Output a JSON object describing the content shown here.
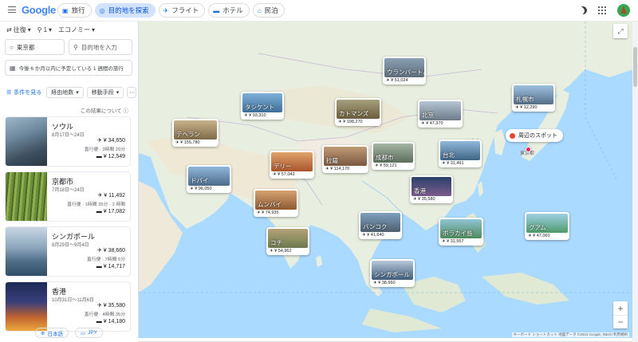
{
  "header": {
    "logo": "Google",
    "tabs": [
      {
        "label": "旅行",
        "icon": "suitcase-icon"
      },
      {
        "label": "目的地を探索",
        "icon": "explore-icon"
      },
      {
        "label": "フライト",
        "icon": "flight-icon"
      },
      {
        "label": "ホテル",
        "icon": "bed-icon"
      },
      {
        "label": "民泊",
        "icon": "house-icon"
      }
    ]
  },
  "search": {
    "trip_type": "往復",
    "passengers": "1",
    "cabin": "エコノミー",
    "origin": "東京都",
    "destination_placeholder": "目的地を入力",
    "dates_placeholder": "今後 6 か月以内に予定している 1 週間の旅行"
  },
  "filters": {
    "all_filters": "条件を見る",
    "stops": "経由地数",
    "transport": "移動手段",
    "about_results": "この結果について"
  },
  "results": [
    {
      "city": "ソウル",
      "dates": "8月17日〜24日",
      "price": "¥ 34,650",
      "duration": "直行便 · 3時間 20分",
      "hotel": "¥ 12,549"
    },
    {
      "city": "京都市",
      "dates": "7月18日〜24日",
      "price": "¥ 11,492",
      "duration": "直行便 · 1時間 35分 · 2 時間",
      "hotel": "¥ 17,082"
    },
    {
      "city": "シンガポール",
      "dates": "8月29日〜9月4日",
      "price": "¥ 38,660",
      "duration": "直行便 · 7時間 5分",
      "hotel": "¥ 14,717"
    },
    {
      "city": "香港",
      "dates": "10月31日〜11月6日",
      "price": "¥ 35,580",
      "duration": "直行便 · 4時間 35分",
      "hotel": "¥ 14,180"
    }
  ],
  "footer": {
    "language": "日本語",
    "currency": "JPY"
  },
  "map": {
    "nearby_label": "周辺のスポット",
    "attribution": "キーボード ショートカット  地図データ ©2024 Google, INEGI  利用規約",
    "city_labels": [
      "ソウル",
      "東京都"
    ],
    "destinations": [
      {
        "name": "ウランバートル",
        "price": "¥ 51,024"
      },
      {
        "name": "札幌市",
        "price": "¥ 12,290"
      },
      {
        "name": "タシケント",
        "price": "¥ 93,310"
      },
      {
        "name": "カトマンズ",
        "price": "¥ 198,270"
      },
      {
        "name": "北京",
        "price": "¥ 47,370"
      },
      {
        "name": "テヘラン",
        "price": "¥ 155,780"
      },
      {
        "name": "デリー",
        "price": "¥ 57,043"
      },
      {
        "name": "成都市",
        "price": "¥ 59,121"
      },
      {
        "name": "台北",
        "price": "¥ 31,491"
      },
      {
        "name": "ドバイ",
        "price": "¥ 96,050"
      },
      {
        "name": "拉薩",
        "price": "¥ 114,170"
      },
      {
        "name": "香港",
        "price": "¥ 35,580"
      },
      {
        "name": "ムンバイ",
        "price": "¥ 74,935"
      },
      {
        "name": "バンコク",
        "price": "¥ 41,640"
      },
      {
        "name": "ボラカイ島",
        "price": "¥ 31,557"
      },
      {
        "name": "グアム",
        "price": "¥ 47,060"
      },
      {
        "name": "コチ",
        "price": "¥ 54,962"
      },
      {
        "name": "シンガポール",
        "price": "¥ 38,660"
      }
    ]
  },
  "colors": {
    "accent": "#1a73e8",
    "active_tab": "#d3e3fd",
    "water": "#aadaff",
    "land": "#e8f0e3",
    "pin": "#ea4335"
  }
}
